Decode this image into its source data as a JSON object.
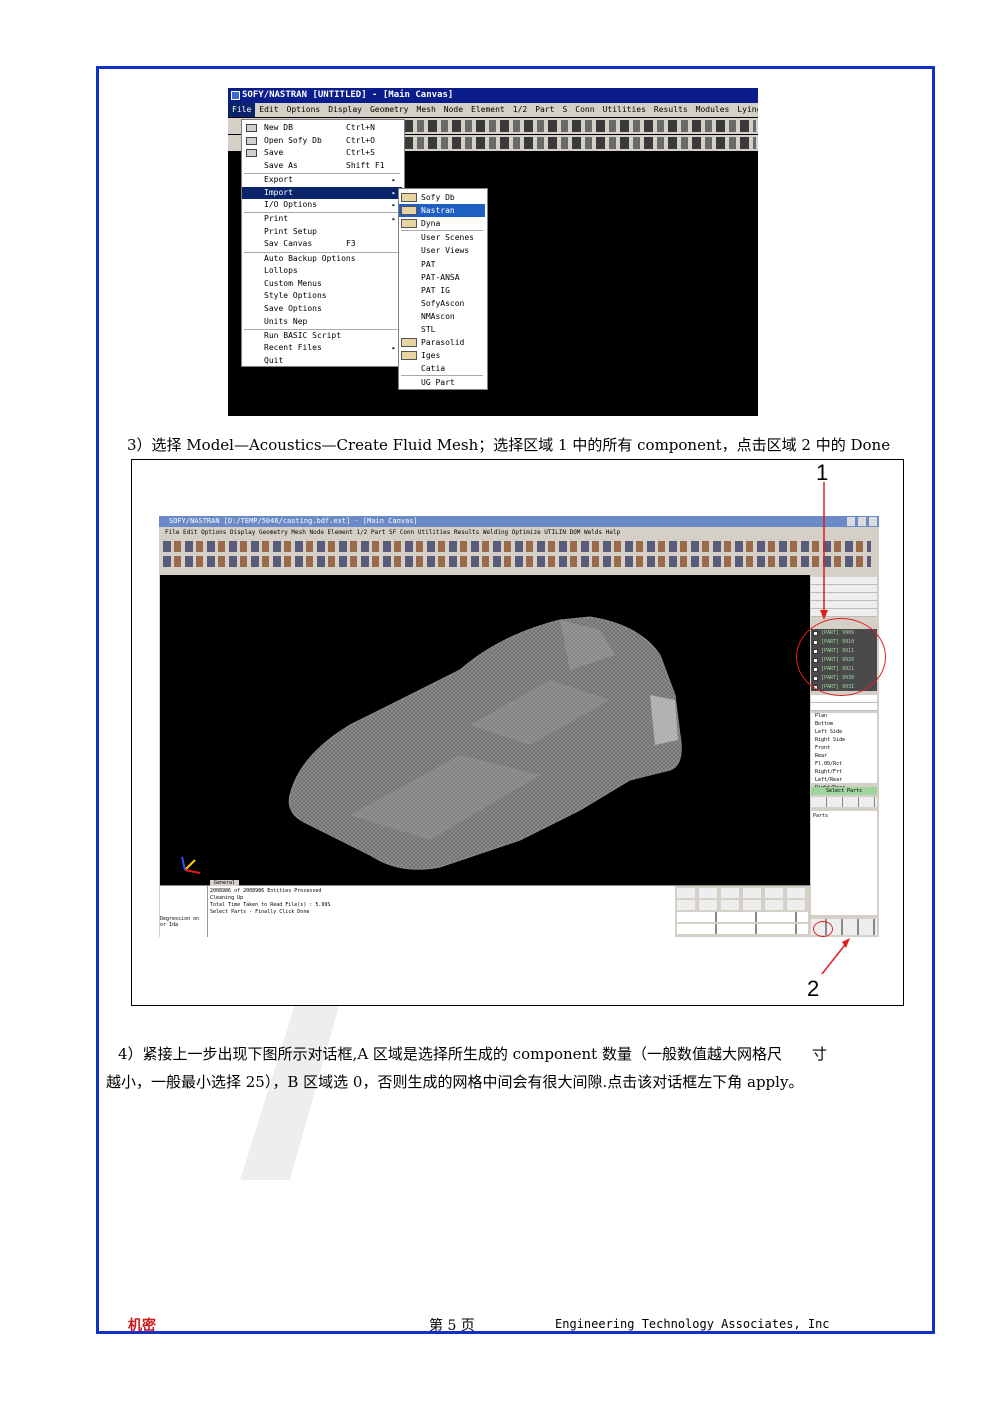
{
  "screenshot1": {
    "title": "SOFY/NASTRAN [UNTITLED] - [Main Canvas]",
    "menubar": [
      "File",
      "Edit",
      "Options",
      "Display",
      "Geometry",
      "Mesh",
      "Node",
      "Element",
      "1/2",
      "Part",
      "S",
      "Conn",
      "Utilities",
      "Results",
      "Modules",
      "Lyingu"
    ],
    "file_menu": [
      {
        "label": "New DB",
        "shortcut": "Ctrl+N",
        "has_icon": true
      },
      {
        "label": "Open Sofy Db",
        "shortcut": "Ctrl+O",
        "has_icon": true
      },
      {
        "label": "Save",
        "shortcut": "Ctrl+S",
        "has_icon": true
      },
      {
        "label": "Save As",
        "shortcut": "Shift F1",
        "has_icon": false
      },
      {
        "label": "Export",
        "shortcut": "",
        "submenu": true
      },
      {
        "label": "Import",
        "shortcut": "",
        "submenu": true,
        "highlighted": true
      },
      {
        "label": "I/O Options",
        "shortcut": "",
        "submenu": true
      },
      {
        "label": "Print",
        "shortcut": "",
        "submenu": true
      },
      {
        "label": "Print Setup",
        "shortcut": ""
      },
      {
        "label": "Sav Canvas",
        "shortcut": "F3"
      },
      {
        "label": "Auto Backup Options",
        "shortcut": ""
      },
      {
        "label": "Lollops",
        "shortcut": ""
      },
      {
        "label": "Custom Menus",
        "shortcut": ""
      },
      {
        "label": "Style Options",
        "shortcut": ""
      },
      {
        "label": "Save Options",
        "shortcut": ""
      },
      {
        "label": "Units Nep",
        "shortcut": ""
      },
      {
        "label": "Run BASIC Script",
        "shortcut": ""
      },
      {
        "label": "Recent Files",
        "shortcut": "",
        "submenu": true
      },
      {
        "label": "Quit",
        "shortcut": ""
      }
    ],
    "import_submenu": [
      {
        "label": "Sofy Db",
        "icon": true
      },
      {
        "label": "Nastran",
        "icon": true,
        "highlighted": true
      },
      {
        "label": "Dyna",
        "icon": true
      },
      {
        "label": "User Scenes",
        "icon": false
      },
      {
        "label": "User Views",
        "icon": false
      },
      {
        "label": "PAT",
        "icon": false
      },
      {
        "label": "PAT-ANSA",
        "icon": false
      },
      {
        "label": "PAT IG",
        "icon": false
      },
      {
        "label": "SofyAscon",
        "icon": false
      },
      {
        "label": "NMAscon",
        "icon": false
      },
      {
        "label": "STL",
        "icon": false
      },
      {
        "label": "Parasolid",
        "icon": true
      },
      {
        "label": "Iges",
        "icon": true
      },
      {
        "label": "Catia",
        "icon": false
      },
      {
        "label": "UG Part",
        "icon": false
      }
    ]
  },
  "step3_text": "3）选择 Model—Acoustics—Create Fluid Mesh；选择区域 1 中的所有 component，点击区域 2 中的 Done",
  "screenshot2": {
    "title": "SOFY/NASTRAN [D:/TEMP/5046/casting.bdf.ext] - [Main Canvas]",
    "menu": "File Edit Options Display Geometry Mesh Node Element 1/2 Part SF Conn Utilities Results Welding Optimize UTILIN DOM Welds Help",
    "callout1": "1",
    "callout2": "2",
    "parts": [
      "[PART] 9909",
      "[PART] 9910",
      "[PART] 9911",
      "[PART] 9920",
      "[PART] 9921",
      "[PART] 9930",
      "[PART] 9931"
    ],
    "views": [
      "Plan",
      "Bottom",
      "Left Side",
      "Right Side",
      "Front",
      "Rear",
      "Fl.00/Rct",
      "Right/Frt",
      "Left/Rear",
      "Right/Rear"
    ],
    "messages": [
      "2008986 of 2008986 Entities Processed",
      "Cleaning Up",
      "Total Time Taken to Read File(s) : 5.99S",
      "Select Parts - Finally Click Done"
    ],
    "tab": "General",
    "status_left": "Degression on or Ida",
    "panel_header": "Select Parts"
  },
  "step4_line1": "4）紧接上一步出现下图所示对话框,A 区域是选择所生成的 component 数量（一般数值越大网格尺　　寸",
  "step4_line2": "越小，一般最小选择 25），B 区域选 0，否则生成的网格中间会有很大间隙.点击该对话框左下角 apply。",
  "footer": {
    "left": "机密",
    "center": "第 5 页",
    "right": "Engineering Technology Associates, Inc"
  },
  "colors": {
    "frame": "#1030c8",
    "footer_left": "#d01818",
    "highlight": "#0a246a"
  }
}
